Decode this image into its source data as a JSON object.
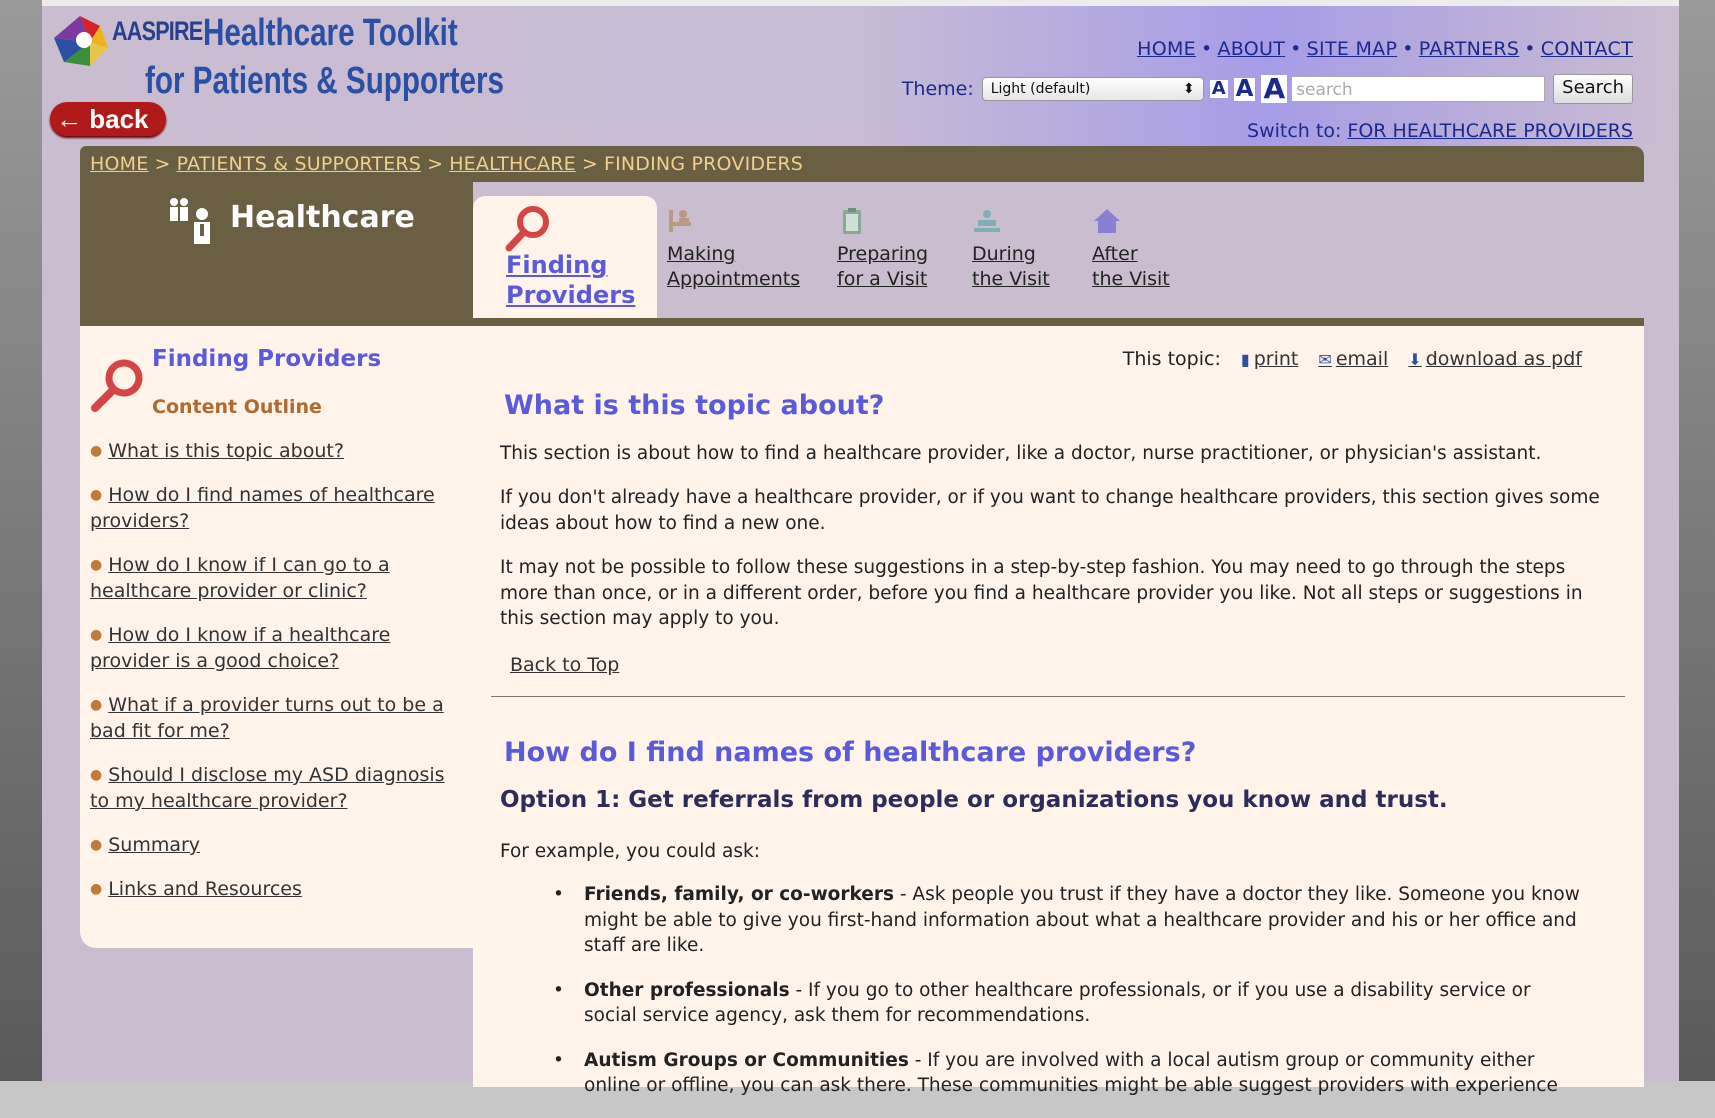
{
  "logo": {
    "aaspire": "AASPIRE",
    "title_line1": "Healthcare Toolkit",
    "title_line2": "for Patients & Supporters"
  },
  "back_button": {
    "label": "← back"
  },
  "top_nav": {
    "items": [
      "HOME",
      "ABOUT",
      "SITE MAP",
      "PARTNERS",
      "CONTACT"
    ]
  },
  "theme": {
    "label": "Theme:",
    "selected": "Light (default)",
    "arrow": "⬍"
  },
  "font_size": {
    "small": "A",
    "medium": "A",
    "large": "A"
  },
  "search": {
    "placeholder": "search",
    "button": "Search"
  },
  "switch": {
    "label": "Switch to:",
    "link": "FOR HEALTHCARE PROVIDERS"
  },
  "breadcrumb": {
    "items": [
      "HOME",
      "PATIENTS & SUPPORTERS",
      "HEALTHCARE"
    ],
    "current": "FINDING PROVIDERS",
    "separator": ">"
  },
  "section": {
    "title": "Healthcare"
  },
  "tabs": {
    "active": {
      "line1": "Finding",
      "line2": "Providers"
    },
    "items": [
      {
        "line1": "Making",
        "line2": "Appointments",
        "icon": "appointment-icon"
      },
      {
        "line1": "Preparing",
        "line2": "for a Visit",
        "icon": "clipboard-icon"
      },
      {
        "line1": "During",
        "line2": "the Visit",
        "icon": "exam-icon"
      },
      {
        "line1": "After",
        "line2": "the Visit",
        "icon": "home-icon"
      }
    ]
  },
  "sidebar": {
    "heading": "Finding Providers",
    "subheading": "Content Outline",
    "outline": [
      "What is this topic about?",
      "How do I find names of healthcare providers?",
      "How do I know if I can go to a healthcare provider or clinic?",
      "How do I know if a healthcare provider is a good choice?",
      "What if a provider turns out to be a bad fit for me?",
      "Should I disclose my ASD diagnosis to my healthcare provider?",
      "Summary",
      "Links and Resources"
    ]
  },
  "topic_tools": {
    "label": "This topic:",
    "print": "print",
    "email": "email",
    "pdf": "download as pdf"
  },
  "main": {
    "h_about": "What is this topic about?",
    "p1": "This section is about how to find a healthcare provider, like a doctor, nurse practitioner, or physician's assistant.",
    "p2": "If you don't already have a healthcare provider, or if you want to change healthcare providers, this section gives some ideas about how to find a new one.",
    "p3": "It may not be possible to follow these suggestions in a step-by-step fashion. You may need to go through the steps more than once, or in a different order, before you find a healthcare provider you like. Not all steps or suggestions in this section may apply to you.",
    "back_to_top": "Back to Top",
    "h_find": "How do I find names of healthcare providers?",
    "h_option1": "Option 1: Get referrals from people or organizations you know and trust.",
    "p_example": "For example, you could ask:",
    "list": [
      {
        "bold": "Friends, family, or co-workers",
        "text": " - Ask people you trust if they have a doctor they like. Someone you know might be able to give you first-hand information about what a healthcare provider and his or her office and staff are like."
      },
      {
        "bold": "Other professionals",
        "text": " - If you go to other healthcare professionals, or if you use a disability service or social service agency, ask them for recommendations."
      },
      {
        "bold": "Autism Groups or Communities",
        "text": " - If you are involved with a local autism group or community either online or offline, you can ask there. These communities might be able suggest providers with experience"
      }
    ]
  },
  "colors": {
    "brown": "#6a5e43",
    "cream": "#fff3ea",
    "accent": "#5b5bd9",
    "nav": "#1b2a8c",
    "crumb": "#f1cf8f"
  }
}
